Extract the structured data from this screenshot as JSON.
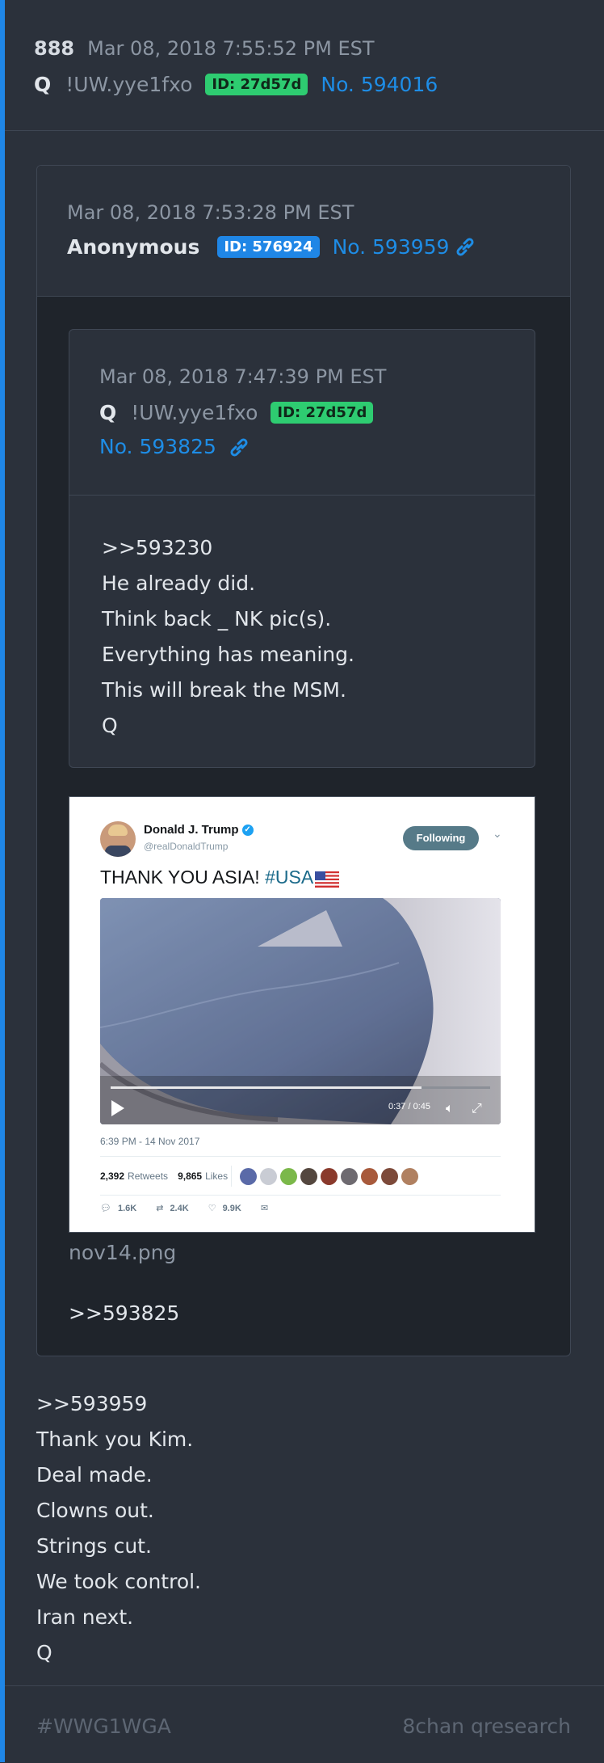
{
  "post": {
    "board_num": "888",
    "date": "Mar 08, 2018 7:55:52 PM EST",
    "name": "Q",
    "trip": "!UW.yye1fxo",
    "id": "ID: 27d57d",
    "number": "No. 594016",
    "body": [
      ">>593959",
      "Thank you Kim.",
      "Deal made.",
      "Clowns out.",
      "Strings cut.",
      "We took control.",
      "Iran next.",
      "Q"
    ]
  },
  "quoted": {
    "date": "Mar 08, 2018 7:53:28 PM EST",
    "name": "Anonymous",
    "id": "ID: 576924",
    "number": "No. 593959",
    "filename": "nov14.png",
    "reply": ">>593825"
  },
  "nested": {
    "date": "Mar 08, 2018 7:47:39 PM EST",
    "name": "Q",
    "trip": "!UW.yye1fxo",
    "id": "ID: 27d57d",
    "number": "No. 593825",
    "body": [
      ">>593230",
      "He already did.",
      "Think back _ NK pic(s).",
      "Everything has meaning.",
      "This will break the MSM.",
      "Q"
    ]
  },
  "tweet": {
    "author": "Donald J. Trump",
    "handle": "@realDonaldTrump",
    "follow_label": "Following",
    "text": "THANK YOU ASIA! ",
    "hashtag": "#USA",
    "video_time": "0:37 / 0:45",
    "video_progress": 0.82,
    "date": "6:39 PM - 14 Nov 2017",
    "retweets_count": "2,392",
    "retweets_label": "Retweets",
    "likes_count": "9,865",
    "likes_label": "Likes",
    "reply_count": "1.6K",
    "retweet_count_short": "2.4K",
    "like_count_short": "9.9K"
  },
  "footer": {
    "hashtag": "#WWG1WGA",
    "source": "8chan qresearch"
  },
  "colors": {
    "accent": "#1f86e6",
    "id_green": "#2ecc71",
    "id_blue": "#1f86e6",
    "link": "#1e8de6"
  }
}
